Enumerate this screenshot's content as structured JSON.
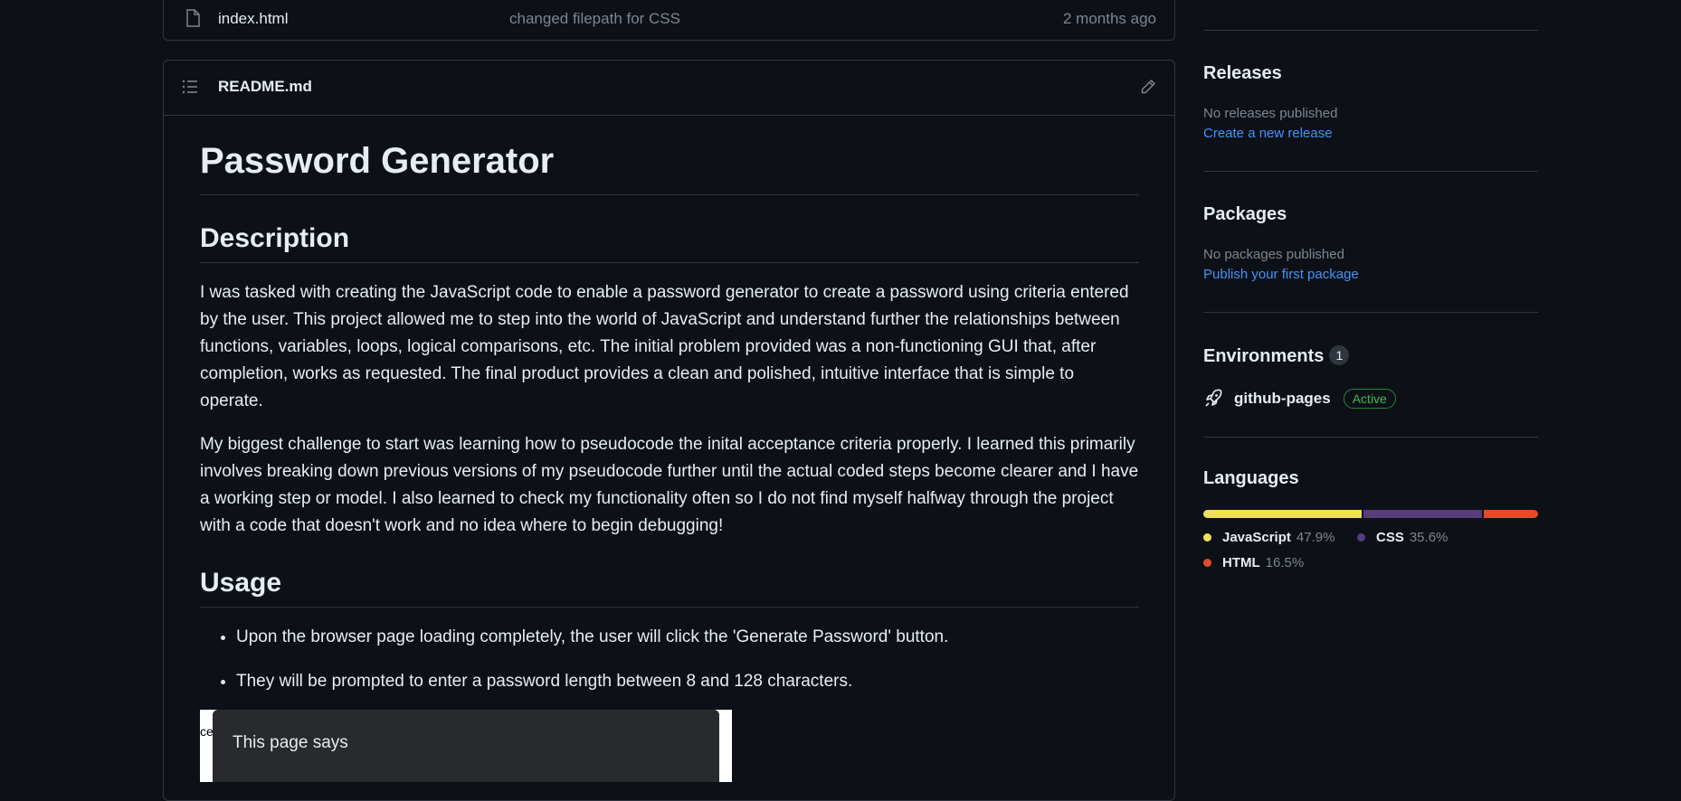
{
  "file": {
    "name": "index.html",
    "message": "changed filepath for CSS",
    "date": "2 months ago"
  },
  "readme": {
    "filename": "README.md",
    "title": "Password Generator",
    "description_heading": "Description",
    "paragraph1": "I was tasked with creating the JavaScript code to enable a password generator to create a password using criteria entered by the user. This project allowed me to step into the world of JavaScript and understand further the relationships between functions, variables, loops, logical comparisons, etc. The initial problem provided was a non-functioning GUI that, after completion, works as requested. The final product provides a clean and polished, intuitive interface that is simple to operate.",
    "paragraph2": "My biggest challenge to start was learning how to pseudocode the inital acceptance criteria properly. I learned this primarily involves breaking down previous versions of my pseudocode further until the actual coded steps become clearer and I have a working step or model. I also learned to check my functionality often so I do not find myself halfway through the project with a code that doesn't work and no idea where to begin debugging!",
    "usage_heading": "Usage",
    "usage_items": [
      "Upon the browser page loading completely, the user will click the 'Generate Password' button.",
      "They will be prompted to enter a password length between 8 and 128 characters."
    ],
    "screenshot": {
      "edge_text": "ce",
      "dialog_text": "This page says"
    }
  },
  "sidebar": {
    "releases": {
      "heading": "Releases",
      "empty": "No releases published",
      "link": "Create a new release"
    },
    "packages": {
      "heading": "Packages",
      "empty": "No packages published",
      "link": "Publish your first package"
    },
    "environments": {
      "heading": "Environments",
      "count": "1",
      "name": "github-pages",
      "status": "Active"
    },
    "languages": {
      "heading": "Languages",
      "items": [
        {
          "name": "JavaScript",
          "percent": "47.9%",
          "value": 47.9,
          "color": "#f1e05a"
        },
        {
          "name": "CSS",
          "percent": "35.6%",
          "value": 35.6,
          "color": "#563d7c"
        },
        {
          "name": "HTML",
          "percent": "16.5%",
          "value": 16.5,
          "color": "#e34c26"
        }
      ]
    }
  }
}
